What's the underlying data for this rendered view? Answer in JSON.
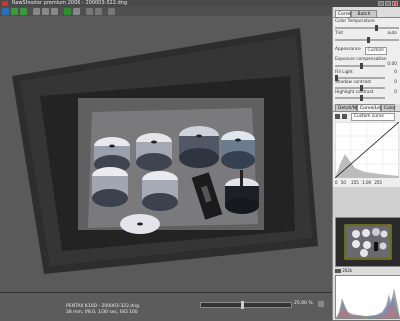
{
  "window": {
    "title": "RawShooter premium 2006 - 200003-322.dng"
  },
  "panel": {
    "tabs": [
      "Correct",
      "Batch convert"
    ],
    "color_temperature_label": "Color Temperature",
    "color_temperature_value": "",
    "tint_label": "Tint",
    "tint_value": "",
    "tint_aux": "auto",
    "appearance_label": "Appearance",
    "appearance_value": "Custom",
    "exposure_label": "Exposure compensation",
    "exposure_value": "0.00",
    "fill_light_label": "Fill Light",
    "fill_light_value": "0",
    "shadow_contrast_label": "Shadow contrast",
    "shadow_contrast_value": "0",
    "highlight_contrast_label": "Highlight contrast",
    "highlight_contrast_value": "0",
    "lower_tabs": [
      "Detail/Noise",
      "Curve/Levels",
      "Color"
    ],
    "curve_mode": "Custom curve",
    "level_values": [
      "0",
      "50",
      "255",
      "1.00",
      "255"
    ],
    "zoom_label": "262k"
  },
  "status": {
    "file_line": "PENTAX K10D - 200003-322.dng",
    "info_line": "28 mm, f/8.0, 1/30 sec, ISO 100",
    "zoom_value": "25.00 %"
  },
  "colors": {
    "panel_bg": "#dcdcdc",
    "canvas_bg": "#595959",
    "accent_green": "#3c9a3c"
  }
}
